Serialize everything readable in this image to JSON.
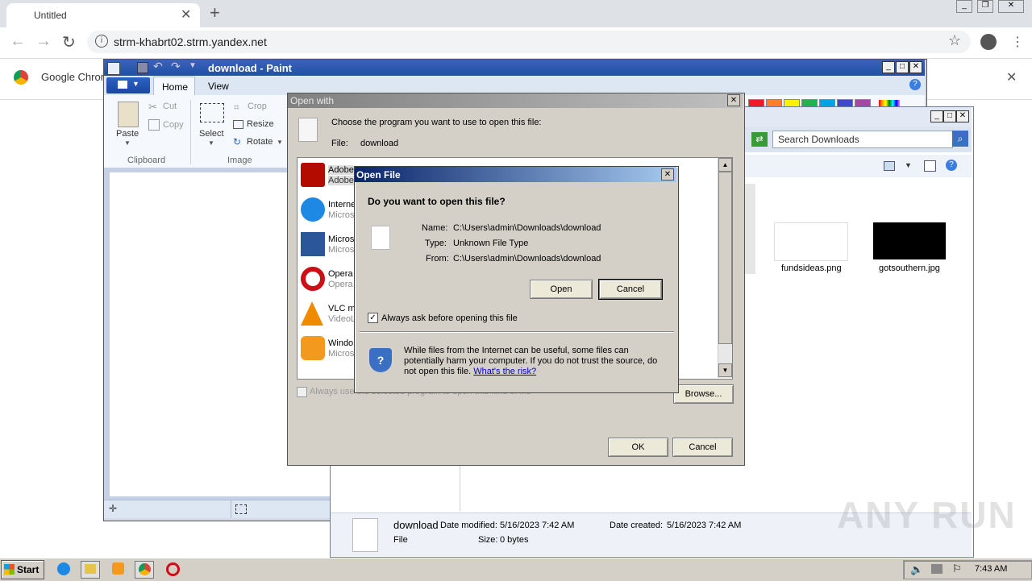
{
  "browser": {
    "tab_title": "Untitled",
    "url": "strm-khabrt02.strm.yandex.net",
    "bookmark_partial": "Google Chrom"
  },
  "paint": {
    "title": "download - Paint",
    "tabs": [
      "Home",
      "View"
    ],
    "paste": "Paste",
    "cut": "Cut",
    "copy": "Copy",
    "clipboard_group": "Clipboard",
    "select": "Select",
    "crop": "Crop",
    "resize": "Resize",
    "rotate": "Rotate",
    "image_group": "Image",
    "palette": [
      "#ed1c24",
      "#ff7f27",
      "#fff200",
      "#22b14c",
      "#00a2e8",
      "#3f48cc",
      "#a349a4"
    ]
  },
  "explorer": {
    "search_placeholder": "Search Downloads",
    "files": [
      {
        "name": "fundsideas.png"
      },
      {
        "name": "gotsouthern.jpg"
      }
    ],
    "details": {
      "name": "download",
      "modified_label": "Date modified:",
      "modified": "5/16/2023 7:42 AM",
      "created_label": "Date created:",
      "created": "5/16/2023 7:42 AM",
      "type": "File",
      "size_label": "Size:",
      "size": "0 bytes"
    }
  },
  "open_with": {
    "title": "Open with",
    "instruction": "Choose the program you want to use to open this file:",
    "file_label": "File:",
    "file_value": "download",
    "programs": [
      {
        "name": "Adobe",
        "sub": "Adobe",
        "icon": "adobe-reader-icon"
      },
      {
        "name": "Interne",
        "sub": "Micros",
        "icon": "internet-explorer-icon"
      },
      {
        "name": "Micros",
        "sub": "Micros",
        "icon": "word-icon"
      },
      {
        "name": "Opera",
        "sub": "Opera",
        "icon": "opera-icon"
      },
      {
        "name": "VLC me",
        "sub": "VideoL",
        "icon": "vlc-icon"
      },
      {
        "name": "Windo",
        "sub": "Micros",
        "icon": "media-player-icon"
      }
    ],
    "always_use": "Always use the selected program to open this kind of file",
    "browse": "Browse...",
    "ok": "OK",
    "cancel": "Cancel"
  },
  "open_file": {
    "title": "Open File",
    "question": "Do you want to open this file?",
    "name_label": "Name:",
    "name_value": "C:\\Users\\admin\\Downloads\\download",
    "type_label": "Type:",
    "type_value": "Unknown File Type",
    "from_label": "From:",
    "from_value": "C:\\Users\\admin\\Downloads\\download",
    "open": "Open",
    "cancel": "Cancel",
    "always_ask": "Always ask before opening this file",
    "always_ask_checked": true,
    "warning": "While files from the Internet can be useful, some files can potentially harm your computer. If you do not trust the source, do not open this file.",
    "risk_link": "What's the risk?"
  },
  "taskbar": {
    "start": "Start",
    "time": "7:43 AM"
  },
  "watermark": "ANY RUN"
}
